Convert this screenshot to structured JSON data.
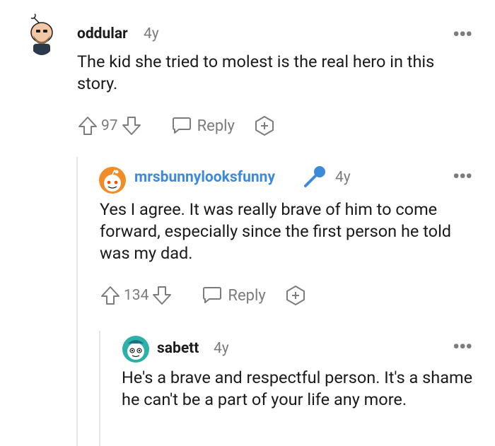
{
  "comments": [
    {
      "username": "oddular",
      "age": "4y",
      "body": "The kid she tried to molest is the real hero in this story.",
      "votes": "97",
      "reply_label": "Reply",
      "avatar_icon": "bald-man-avatar-icon"
    },
    {
      "username": "mrsbunnylooksfunny",
      "age": "4y",
      "body": "Yes I agree. It was really brave of him to come forward, especially since the first person he told was my dad.",
      "votes": "134",
      "reply_label": "Reply",
      "avatar_icon": "snoo-orange-avatar-icon",
      "flair_icon": "microphone-icon",
      "username_color": "#3d8bd8"
    },
    {
      "username": "sabett",
      "age": "4y",
      "body": "He's a brave and respectful person. It's a shame he can't be a part of your life any more.",
      "avatar_icon": "snoo-teal-avatar-icon"
    }
  ],
  "colors": {
    "meta": "#7c7c7c",
    "thread_line": "#e6e6e6",
    "text": "#1a1a1b"
  }
}
